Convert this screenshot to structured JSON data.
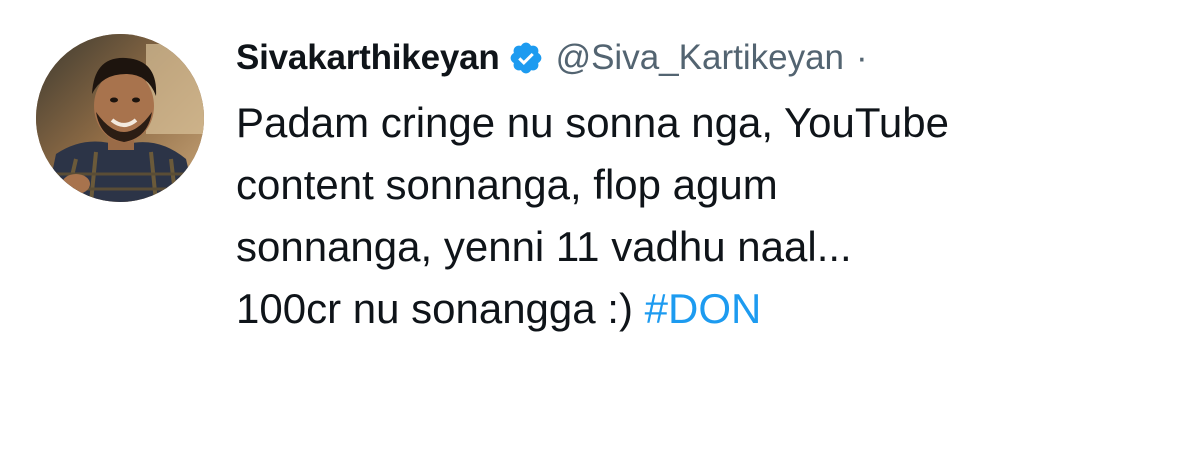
{
  "tweet": {
    "author_name": "Sivakarthikeyan",
    "author_handle": "@Siva_Kartikeyan",
    "separator": "·",
    "verified_icon": "verified-badge-icon",
    "lines": [
      "Padam cringe nu sonna nga, YouTube",
      "content sonnanga, flop agum",
      "sonnanga, yenni 11 vadhu naal...",
      "100cr nu sonangga :)"
    ],
    "hashtag": "#DON",
    "colors": {
      "hashtag": "#1d9bf0",
      "verified": "#1d9bf0",
      "handle": "#536471",
      "text": "#0f1419"
    }
  }
}
